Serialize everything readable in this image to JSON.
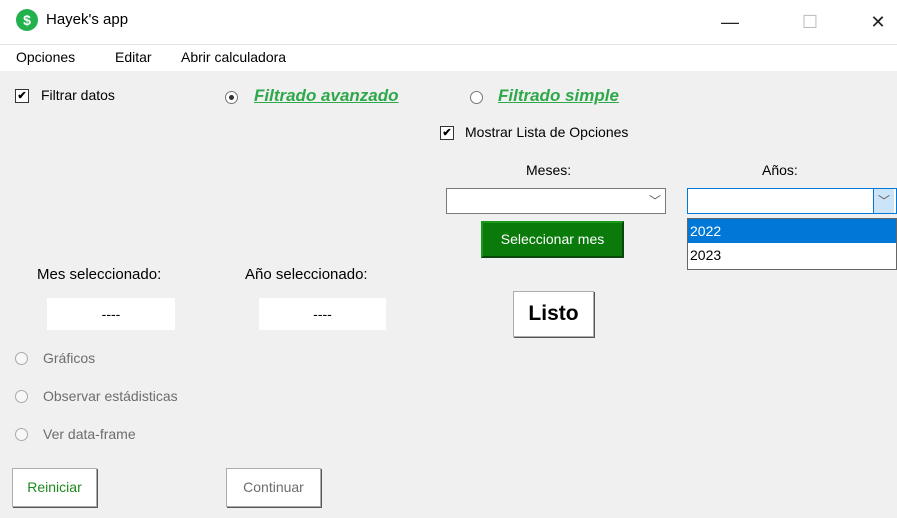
{
  "window": {
    "title": "Hayek's app",
    "icon": "dollar-app-icon",
    "icon_glyph": "$"
  },
  "window_controls": {
    "minimize": "—",
    "maximize": "☐",
    "close": "✕"
  },
  "menu": [
    "Opciones",
    "Editar",
    "Abrir calculadora"
  ],
  "filter_checkbox": {
    "label": "Filtrar datos",
    "checked": true
  },
  "filter_modes": {
    "advanced": {
      "label": "Filtrado avanzado",
      "selected": true
    },
    "simple": {
      "label": "Filtrado simple",
      "selected": false
    }
  },
  "show_options": {
    "label": "Mostrar Lista de Opciones",
    "checked": true
  },
  "months": {
    "label": "Meses:",
    "value": "",
    "button": "Seleccionar mes"
  },
  "years": {
    "label": "Años:",
    "value": "",
    "options": [
      "2022",
      "2023"
    ],
    "highlighted": "2022"
  },
  "selected_month": {
    "label": "Mes seleccionado:",
    "value": "----"
  },
  "selected_year": {
    "label": "Año seleccionado:",
    "value": "----"
  },
  "listo_button": "Listo",
  "views": [
    "Gráficos",
    "Observar estádisticas",
    "Ver data-frame"
  ],
  "reset_button": "Reiniciar",
  "continue_button": "Continuar",
  "colors": {
    "accent_green": "#2ea84a",
    "button_green": "#0a7a0a",
    "selection_blue": "#0078d7"
  }
}
